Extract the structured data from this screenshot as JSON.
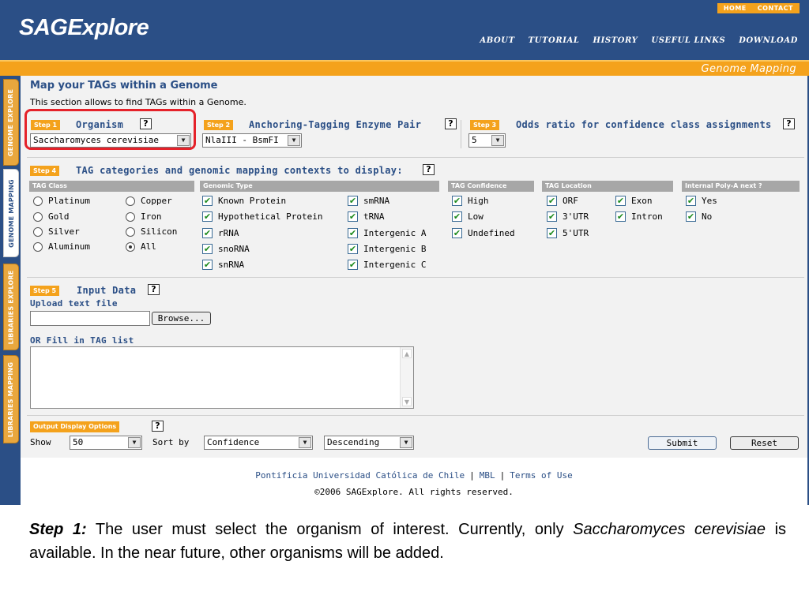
{
  "app": {
    "logo": "SAGExplore"
  },
  "top_links": {
    "home": "HOME",
    "contact": "CONTACT"
  },
  "nav": [
    "ABOUT",
    "TUTORIAL",
    "HISTORY",
    "USEFUL LINKS",
    "DOWNLOAD"
  ],
  "section_banner": "Genome Mapping",
  "side_tabs": [
    {
      "label": "GENOME EXPLORE",
      "active": false
    },
    {
      "label": "GENOME MAPPING",
      "active": true
    },
    {
      "label": "LIBRARIES EXPLORE",
      "active": false
    },
    {
      "label": "LIBRARIES MAPPING",
      "active": false
    }
  ],
  "page": {
    "title": "Map your TAGs within a Genome",
    "subtitle": "This section allows to find TAGs within a Genome."
  },
  "help_glyph": "?",
  "select_arrow": "▼",
  "step1": {
    "badge": "Step 1",
    "label": "Organism",
    "value": "Saccharomyces cerevisiae"
  },
  "step2": {
    "badge": "Step 2",
    "label": "Anchoring-Tagging Enzyme Pair",
    "value": "NlaIII - BsmFI"
  },
  "step3": {
    "badge": "Step 3",
    "label": "Odds ratio for confidence class assignments",
    "value": "5"
  },
  "step4": {
    "badge": "Step 4",
    "label": "TAG categories and genomic mapping contexts to display:",
    "headers": {
      "tag_class": "TAG Class",
      "genomic_type": "Genomic Type",
      "tag_confidence": "TAG Confidence",
      "tag_location": "TAG Location",
      "poly_a": "Internal Poly-A next ?"
    },
    "tag_class": {
      "col1": [
        "Platinum",
        "Gold",
        "Silver",
        "Aluminum"
      ],
      "col2": [
        "Copper",
        "Iron",
        "Silicon",
        "All"
      ],
      "selected": "All"
    },
    "genomic_type": {
      "col1": [
        "Known Protein",
        "Hypothetical Protein",
        "rRNA",
        "snoRNA",
        "snRNA"
      ],
      "col2": [
        "smRNA",
        "tRNA",
        "Intergenic A",
        "Intergenic B",
        "Intergenic C"
      ]
    },
    "tag_confidence": [
      "High",
      "Low",
      "Undefined"
    ],
    "tag_location": {
      "col1": [
        "ORF",
        "3'UTR",
        "5'UTR"
      ],
      "col2": [
        "Exon",
        "Intron"
      ]
    },
    "poly_a": [
      "Yes",
      "No"
    ],
    "check_glyph": "✔"
  },
  "step5": {
    "badge": "Step 5",
    "label": "Input Data",
    "upload_label": "Upload text file",
    "browse_label": "Browse...",
    "fill_label": "OR Fill in TAG list",
    "scroll_up": "▲",
    "scroll_down": "▼"
  },
  "output": {
    "badge": "Output Display Options",
    "show_label": "Show",
    "show_value": "50",
    "sort_label": "Sort by",
    "sort_value": "Confidence",
    "order_value": "Descending",
    "submit_label": "Submit",
    "reset_label": "Reset"
  },
  "footer": {
    "links": [
      "Pontificia Universidad Católica de Chile",
      "MBL",
      "Terms of Use"
    ],
    "separator": "|",
    "copyright": "©2006 SAGExplore. All rights reserved."
  },
  "caption": {
    "step": "Step 1:",
    "text1": " The user must select the organism of interest. Currently, only ",
    "species": "Saccharomyces cerevisiae",
    "text2": " is available. In the near future, other organisms will be added."
  },
  "colors": {
    "brand_blue": "#2b4f86",
    "accent_orange": "#f4a21c",
    "highlight_red": "#e5222a",
    "header_gray": "#a7a7a7",
    "check_green": "#1c8a1c"
  }
}
